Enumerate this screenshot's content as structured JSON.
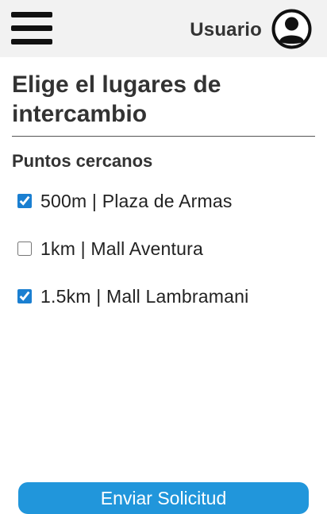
{
  "header": {
    "user_label": "Usuario",
    "menu_icon": "hamburger-menu-icon",
    "avatar_icon": "user-account-icon"
  },
  "main": {
    "title": "Elige el lugares de intercambio",
    "section_title": "Puntos cercanos",
    "options": [
      {
        "label": "500m | Plaza de Armas",
        "checked": true
      },
      {
        "label": "1km | Mall Aventura",
        "checked": false
      },
      {
        "label": "1.5km | Mall Lambramani",
        "checked": true
      }
    ]
  },
  "footer": {
    "submit_label": "Enviar Solicitud"
  },
  "colors": {
    "accent": "#2196db",
    "header_bg": "#f2f2f2",
    "text": "#333333"
  }
}
